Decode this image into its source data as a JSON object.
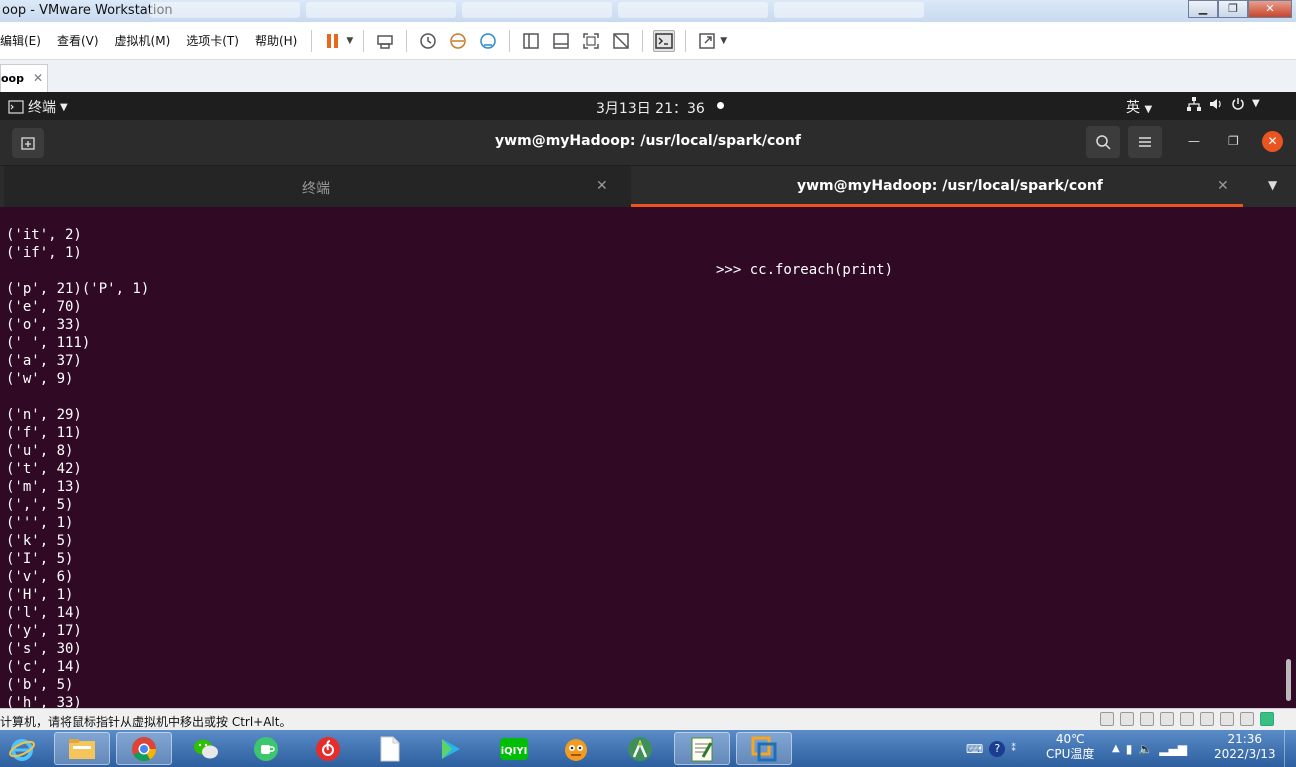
{
  "vmware": {
    "title": "oop - VMware Workstation",
    "menu": [
      "编辑(E)",
      "查看(V)",
      "虚拟机(M)",
      "选项卡(T)",
      "帮助(H)"
    ],
    "vm_tab": {
      "label": "oop",
      "close": "✕"
    },
    "status_text": "计算机，请将鼠标指针从虚拟机中移出或按 Ctrl+Alt。"
  },
  "gnome": {
    "app_menu": "终端",
    "clock": "3月13日  21：36",
    "input_method": "英"
  },
  "terminal": {
    "window_title": "ywm@myHadoop: /usr/local/spark/conf",
    "tabs": [
      {
        "label": "终端",
        "active": false
      },
      {
        "label": "ywm@myHadoop: /usr/local/spark/conf",
        "active": true
      }
    ],
    "lines": [
      "('it', 2)",
      "('if', 1)",
      "",
      "('p', 21)('P', 1)",
      "('e', 70)",
      "('o', 33)",
      "(' ', 111)",
      "('a', 37)",
      "('w', 9)",
      "",
      "('n', 29)",
      "('f', 11)",
      "('u', 8)",
      "('t', 42)",
      "('m', 13)",
      "(',', 5)",
      "(''', 1)",
      "('k', 5)",
      "('I', 5)",
      "('v', 6)",
      "('H', 1)",
      "('l', 14)",
      "('y', 17)",
      "('s', 30)",
      "('c', 14)",
      "('b', 5)",
      "('h', 33)"
    ],
    "prompt_line": ">>> cc.foreach(print)"
  },
  "taskbar": {
    "temperature": "40℃",
    "temperature_label": "CPU温度",
    "time": "21:36",
    "date": "2022/3/13"
  },
  "colors": {
    "terminal_bg": "#300a24",
    "ubuntu_orange": "#e95420",
    "header_bg": "#2c2c2c"
  }
}
